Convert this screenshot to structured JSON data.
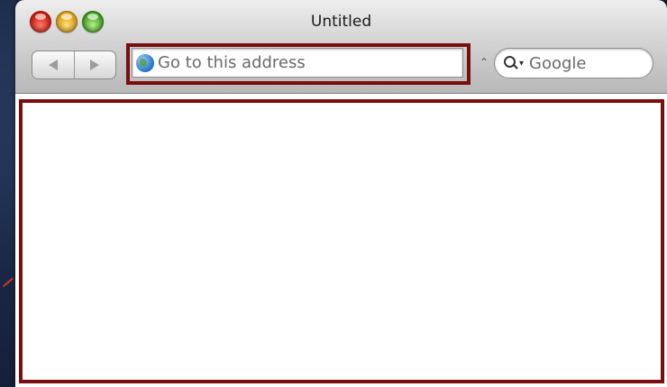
{
  "window": {
    "title": "Untitled"
  },
  "toolbar": {
    "back_icon": "back-arrow-icon",
    "forward_icon": "forward-arrow-icon"
  },
  "address_bar": {
    "placeholder": "Go to this address",
    "icon": "globe-icon"
  },
  "search": {
    "placeholder": "Google",
    "icon": "search-icon"
  },
  "annotations": {
    "color": "#e0321c",
    "highlight_color": "#7a0d0d"
  }
}
